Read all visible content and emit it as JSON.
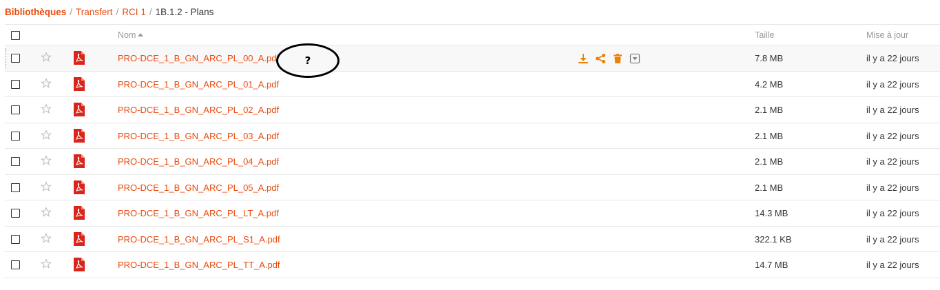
{
  "breadcrumb": {
    "root": "Bibliothèques",
    "items": [
      "Transfert",
      "RCI 1"
    ],
    "current": "1B.1.2 - Plans",
    "separator": "/"
  },
  "table": {
    "columns": {
      "name": "Nom",
      "size": "Taille",
      "modified": "Mise à jour"
    },
    "rows": [
      {
        "name": "PRO-DCE_1_B_GN_ARC_PL_00_A.pdf",
        "size": "7.8 MB",
        "modified": "il y a 22 jours"
      },
      {
        "name": "PRO-DCE_1_B_GN_ARC_PL_01_A.pdf",
        "size": "4.2 MB",
        "modified": "il y a 22 jours"
      },
      {
        "name": "PRO-DCE_1_B_GN_ARC_PL_02_A.pdf",
        "size": "2.1 MB",
        "modified": "il y a 22 jours"
      },
      {
        "name": "PRO-DCE_1_B_GN_ARC_PL_03_A.pdf",
        "size": "2.1 MB",
        "modified": "il y a 22 jours"
      },
      {
        "name": "PRO-DCE_1_B_GN_ARC_PL_04_A.pdf",
        "size": "2.1 MB",
        "modified": "il y a 22 jours"
      },
      {
        "name": "PRO-DCE_1_B_GN_ARC_PL_05_A.pdf",
        "size": "2.1 MB",
        "modified": "il y a 22 jours"
      },
      {
        "name": "PRO-DCE_1_B_GN_ARC_PL_LT_A.pdf",
        "size": "14.3 MB",
        "modified": "il y a 22 jours"
      },
      {
        "name": "PRO-DCE_1_B_GN_ARC_PL_S1_A.pdf",
        "size": "322.1 KB",
        "modified": "il y a 22 jours"
      },
      {
        "name": "PRO-DCE_1_B_GN_ARC_PL_TT_A.pdf",
        "size": "14.7 MB",
        "modified": "il y a 22 jours"
      }
    ],
    "hovered_row_actions": [
      "download-icon",
      "share-icon",
      "delete-icon",
      "more-dropdown-icon"
    ]
  },
  "annotation": {
    "text": "?"
  },
  "colors": {
    "accent": "#ea4a0c",
    "action_orange": "#eb8205",
    "pdf_red": "#d9261c",
    "muted": "#999999"
  }
}
